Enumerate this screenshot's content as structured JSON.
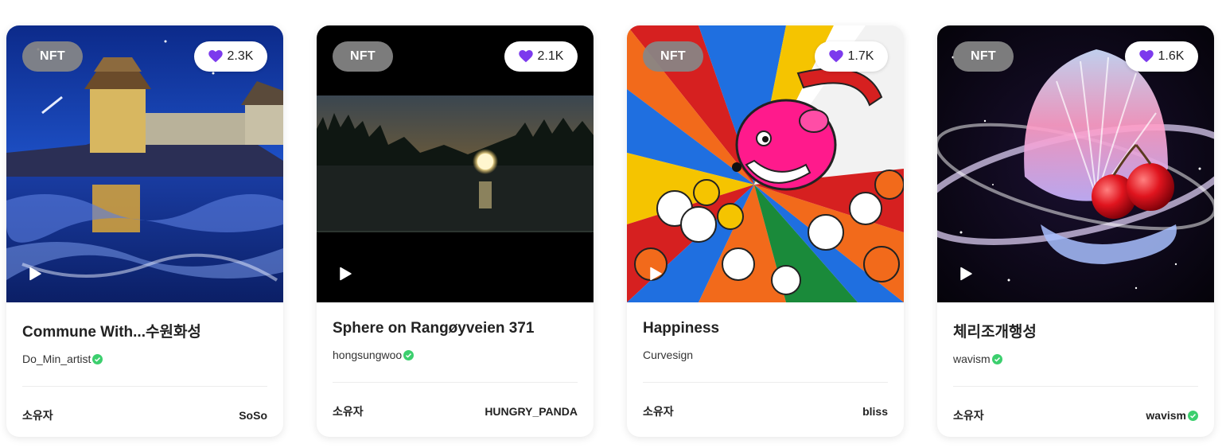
{
  "cards": [
    {
      "badge": "NFT",
      "likes": "2.3K",
      "title": "Commune With...수원화성",
      "creator": "Do_Min_artist",
      "creator_verified": true,
      "owner_label": "소유자",
      "owner": "SoSo",
      "owner_verified": false
    },
    {
      "badge": "NFT",
      "likes": "2.1K",
      "title": "Sphere on Rangøyveien 371",
      "creator": "hongsungwoo",
      "creator_verified": true,
      "owner_label": "소유자",
      "owner": "HUNGRY_PANDA",
      "owner_verified": false
    },
    {
      "badge": "NFT",
      "likes": "1.7K",
      "title": "Happiness",
      "creator": "Curvesign",
      "creator_verified": false,
      "owner_label": "소유자",
      "owner": "bliss",
      "owner_verified": false
    },
    {
      "badge": "NFT",
      "likes": "1.6K",
      "title": "체리조개행성",
      "creator": "wavism",
      "creator_verified": true,
      "owner_label": "소유자",
      "owner": "wavism",
      "owner_verified": true
    }
  ],
  "colors": {
    "heart": "#7c3aed",
    "verified": "#3ccf6e",
    "badge_bg": "#878787"
  },
  "icons": {
    "like": "heart-icon",
    "play": "play-icon",
    "verified": "verified-check-icon"
  }
}
